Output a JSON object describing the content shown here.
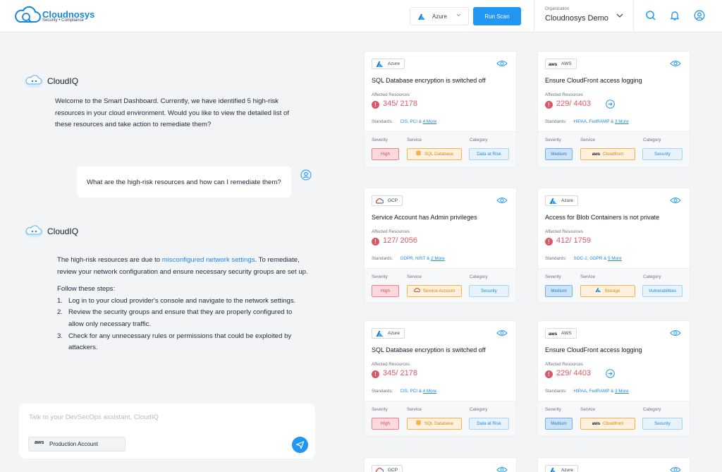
{
  "brand": {
    "name": "Cloudnosys",
    "tagline": "Security • Compliance"
  },
  "header": {
    "cloud_select": "Azure",
    "run_scan_label": "Run Scan",
    "org_label": "Organization",
    "org_value": "Cloudnosys Demo"
  },
  "colors": {
    "accent": "#2196f3",
    "danger": "#e05563",
    "aws": "#ff9900",
    "azure": "#0a7cd6"
  },
  "chat": {
    "bot_name": "CloudIQ",
    "bot_msg_1": "Welcome to the Smart Dashboard. Currently, we have identified 5 high-risk resources in your cloud environment. Would you like to view the detailed list of these resources and take action to remediate them?",
    "user_msg": "What are the high-risk resources and how can I remediate them?",
    "bot_msg_2_pre": "The high-risk resources are due to ",
    "bot_msg_2_link": "misconfigured network settings",
    "bot_msg_2_post": ". To remediate, review your network configuration and ensure necessary security groups are set up.",
    "steps_title": "Follow these steps:",
    "steps": [
      {
        "num": "1.",
        "text": "Log in to your cloud provider's console and navigate to the network settings."
      },
      {
        "num": "2.",
        "text": "Review the security groups and ensure that they are properly configured to allow only necessary traffic."
      },
      {
        "num": "3.",
        "text": "Check for any unnecessary rules or permissions that could be exploited by attackers."
      }
    ],
    "composer_placeholder": "Talk to your DevSecOps assistant, CloudIQ",
    "account_badge": "aws",
    "account_label": "Production Account"
  },
  "cards": [
    {
      "provider": "Azure",
      "title": "SQL Database encryption is switched off",
      "affected_label": "Affected Resources",
      "count": "345/ 2178",
      "standards_label": "Standards:",
      "standards": "CIS, PCI &",
      "more": "4 More",
      "severity_label": "Severity",
      "service_label": "Service",
      "category_label": "Category",
      "severity": "High",
      "service": "SQL Database",
      "category": "Data at Risk"
    },
    {
      "provider": "AWS",
      "provider_badge": "aws",
      "title": "Ensure CloudFront access logging",
      "affected_label": "Affected Resources",
      "count": "229/ 4403",
      "standards_label": "Standards:",
      "standards": "HIPAA, FedRAMP &",
      "more": "3 More",
      "severity_label": "Severity",
      "service_label": "Service",
      "category_label": "Category",
      "severity": "Medium",
      "service_badge": "aws",
      "service": "Cloudfront",
      "category": "Security"
    },
    {
      "provider": "GCP",
      "title": "Service Account has Admin privileges",
      "affected_label": "Affected Resources",
      "count": "127/ 2056",
      "standards_label": "Standards:",
      "standards": "GDPR, NIST &",
      "more": "2 More",
      "severity_label": "Severity",
      "service_label": "Service",
      "category_label": "Category",
      "severity": "High",
      "service": "Service Account",
      "category": "Security"
    },
    {
      "provider": "Azure",
      "title": "Access for Blob Containers is not private",
      "affected_label": "Affected Resources",
      "count": "412/ 1759",
      "standards_label": "Standards:",
      "standards": "SOC-2, GDPR &",
      "more": "5 More",
      "severity_label": "Severity",
      "service_label": "Service",
      "category_label": "Category",
      "severity": "Medium",
      "service": "Storage",
      "category": "Vulnerabilities"
    },
    {
      "provider": "Azure",
      "title": "SQL Database encryption is switched off",
      "affected_label": "Affected Resources",
      "count": "345/ 2178",
      "standards_label": "Standards:",
      "standards": "CIS, PCI &",
      "more": "4 More",
      "severity_label": "Severity",
      "service_label": "Service",
      "category_label": "Category",
      "severity": "High",
      "service": "SQL Database",
      "category": "Data at Risk"
    },
    {
      "provider": "AWS",
      "provider_badge": "aws",
      "title": "Ensure CloudFront access logging",
      "affected_label": "Affected Resources",
      "count": "229/ 4403",
      "standards_label": "Standards:",
      "standards": "HIPAA, FedRAMP &",
      "more": "3 More",
      "severity_label": "Severity",
      "service_label": "Service",
      "category_label": "Category",
      "severity": "Medium",
      "service_badge": "aws",
      "service": "Cloudfront",
      "category": "Security"
    },
    {
      "provider": "GCP"
    },
    {
      "provider": "Azure"
    }
  ]
}
